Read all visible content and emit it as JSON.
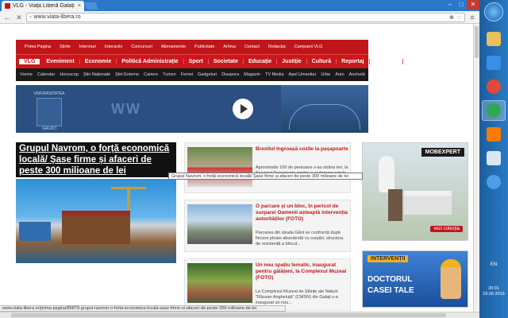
{
  "browser": {
    "tab_title": "VLG - Viața Liberă Galați",
    "tab_close": "×",
    "url": "www.viata-libera.ro",
    "status_url": "www.viata-libera.ro/prima-pagina/89879-grupul-navrom-o-forta-economica-locala-sase-firme-si-afaceri-de-peste-300-milioane-de-lei",
    "zoom_icon": "zoom-icon",
    "star": "☆",
    "menu": "≡",
    "back": "←",
    "stop": "✕"
  },
  "topbar": {
    "items": [
      "Prima Pagina",
      "Știrile",
      "Interviuri",
      "Interactiv",
      "Concursuri",
      "Abonamente",
      "Publicitate",
      "Arhiva",
      "Contact",
      "Redacția",
      "Campanii VLG"
    ]
  },
  "mainnav": {
    "vlg": "VLG",
    "items": [
      "Eveniment",
      "Economie",
      "Politică Administrație",
      "Sport",
      "Societate",
      "Educație",
      "Justiție",
      "Cultură",
      "Reportaj",
      "Sănătate"
    ]
  },
  "subnav": {
    "items": [
      "Vreme",
      "Calendar",
      "Horoscop",
      "Știri Naționale",
      "Știri Externe",
      "Cariere",
      "Turism",
      "Femei",
      "Gadgeturi",
      "Diaspora",
      "Magazin",
      "TV Media",
      "Apel Umanitar",
      "Urbe",
      "Auto",
      "Anchetă",
      "Minor",
      "Ultimele Ştiri"
    ]
  },
  "banner": {
    "left_title": "UNIVERSITATEA",
    "left_sub": "GALAȚI",
    "mid_text": "WW"
  },
  "feature": {
    "title": "Grupul Navrom, o forță economică locală/ Șase firme și afaceri de peste 300 milioane de lei"
  },
  "tooltip": "Grupul Navrom, o forță economică locală/ Șase firme și afaceri de peste 300 milioane de lei",
  "stories": [
    {
      "headline": "Brexitul îngroașă cozile la pașapoarte",
      "snippet": "Aproximativ 100 de persoane s-au strâns ieri, la Serviciul Pașapoarte pentru a-și depune actele în vederea o..."
    },
    {
      "headline": "O parcare și un bloc, în pericol de surpare/ Oamenii așteaptă intervenția autorităților (FOTO)",
      "snippet": "Parcarea din strada Gării se confruntă după fiecare ploaie abundentă cu surpări, structura de rezistență a blocul..."
    },
    {
      "headline": "Un nou spațiu tematic, inaugurat pentru gălățeni, la Complexul Muzeal (FOTO)",
      "snippet": "La Complexul Muzeal de Științe ale Naturii \"Răsvan Angheluță\" (CMSN) din Galați s-a inaugurat un nou..."
    }
  ],
  "ads": {
    "mobexpert": {
      "brand": "MOBEXPERT",
      "cta": "vezi colecția"
    },
    "interventii": {
      "top": "INTERVENȚII",
      "line1": "DOCTORUL",
      "line2": "CASEI TALE"
    }
  },
  "taskbar": {
    "tray_lang": "EN",
    "time": "20:01",
    "date": "19.06.2016"
  }
}
